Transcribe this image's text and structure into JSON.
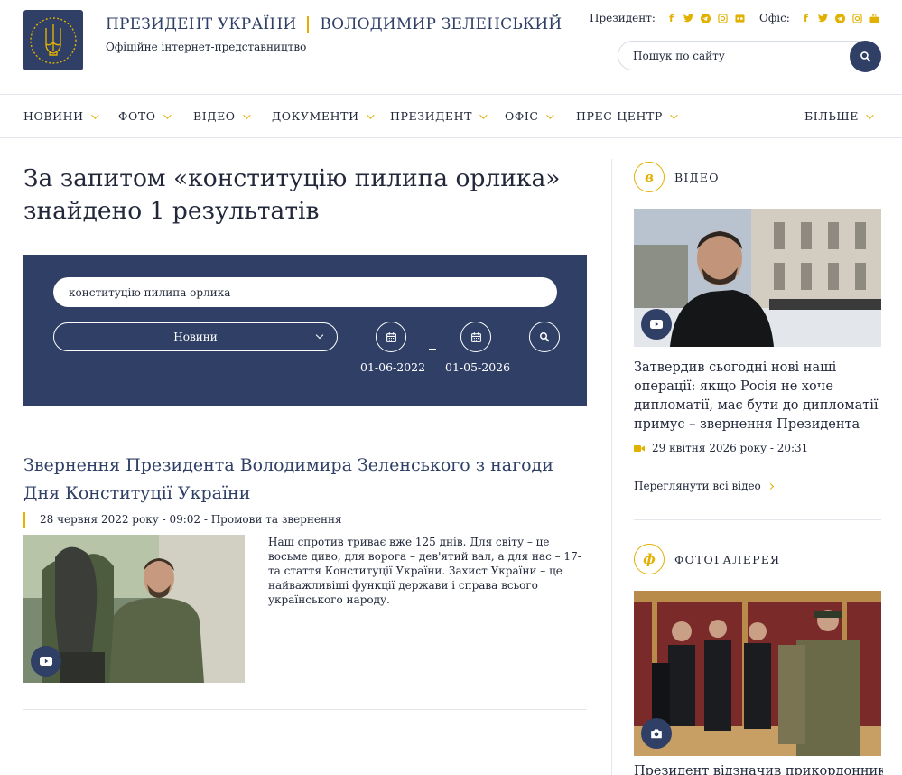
{
  "header": {
    "title_left": "ПРЕЗИДЕНТ УКРАЇНИ",
    "title_right": "ВОЛОДИМИР ЗЕЛЕНСЬКИЙ",
    "subtitle": "Офіційне інтернет-представництво",
    "president_label": "Президент:",
    "office_label": "Офіс:",
    "search_placeholder": "Пошук по сайту"
  },
  "nav": {
    "items": [
      {
        "label": "НОВИНИ"
      },
      {
        "label": "ФОТО"
      },
      {
        "label": "ВІДЕО"
      },
      {
        "label": "ДОКУМЕНТИ"
      },
      {
        "label": "ПРЕЗИДЕНТ"
      },
      {
        "label": "ОФІС"
      },
      {
        "label": "ПРЕС-ЦЕНТР"
      }
    ],
    "more": "БІЛЬШЕ"
  },
  "results": {
    "heading": "За запитом «конституцію пилипа орлика» знайдено 1 результатів"
  },
  "filters": {
    "query": "конституцію пилипа орлика",
    "type": "Новини",
    "date_from": "01-06-2022",
    "date_to": "01-05-2026"
  },
  "article": {
    "title": "Звернення Президента Володимира Зеленського з нагоди Дня Конституції України",
    "meta": "28 червня 2022 року - 09:02 - Промови та звернення",
    "text": "Наш спротив триває вже 125 днів. Для світу – це восьме диво, для ворога – дев'ятий вал, а для нас – 17-та стаття Конституції України. Захист України – це найважливіші функції держави і справа всього українського народу."
  },
  "sidebar": {
    "video": {
      "heading": "ВІДЕО",
      "badge": "в",
      "title": "Затвердив сьогодні нові наші операції: якщо Росія не хоче дипломатії, має бути до дипломатії примус – звернення Президента",
      "meta": "29 квітня 2026 року - 20:31",
      "all_link": "Переглянути всі відео"
    },
    "photo": {
      "heading": "ФОТОГАЛЕРЕЯ",
      "badge": "ф",
      "title": "Президент відзначив прикордонників"
    }
  },
  "colors": {
    "navy": "#2f3f66",
    "gold": "#e2b100"
  }
}
